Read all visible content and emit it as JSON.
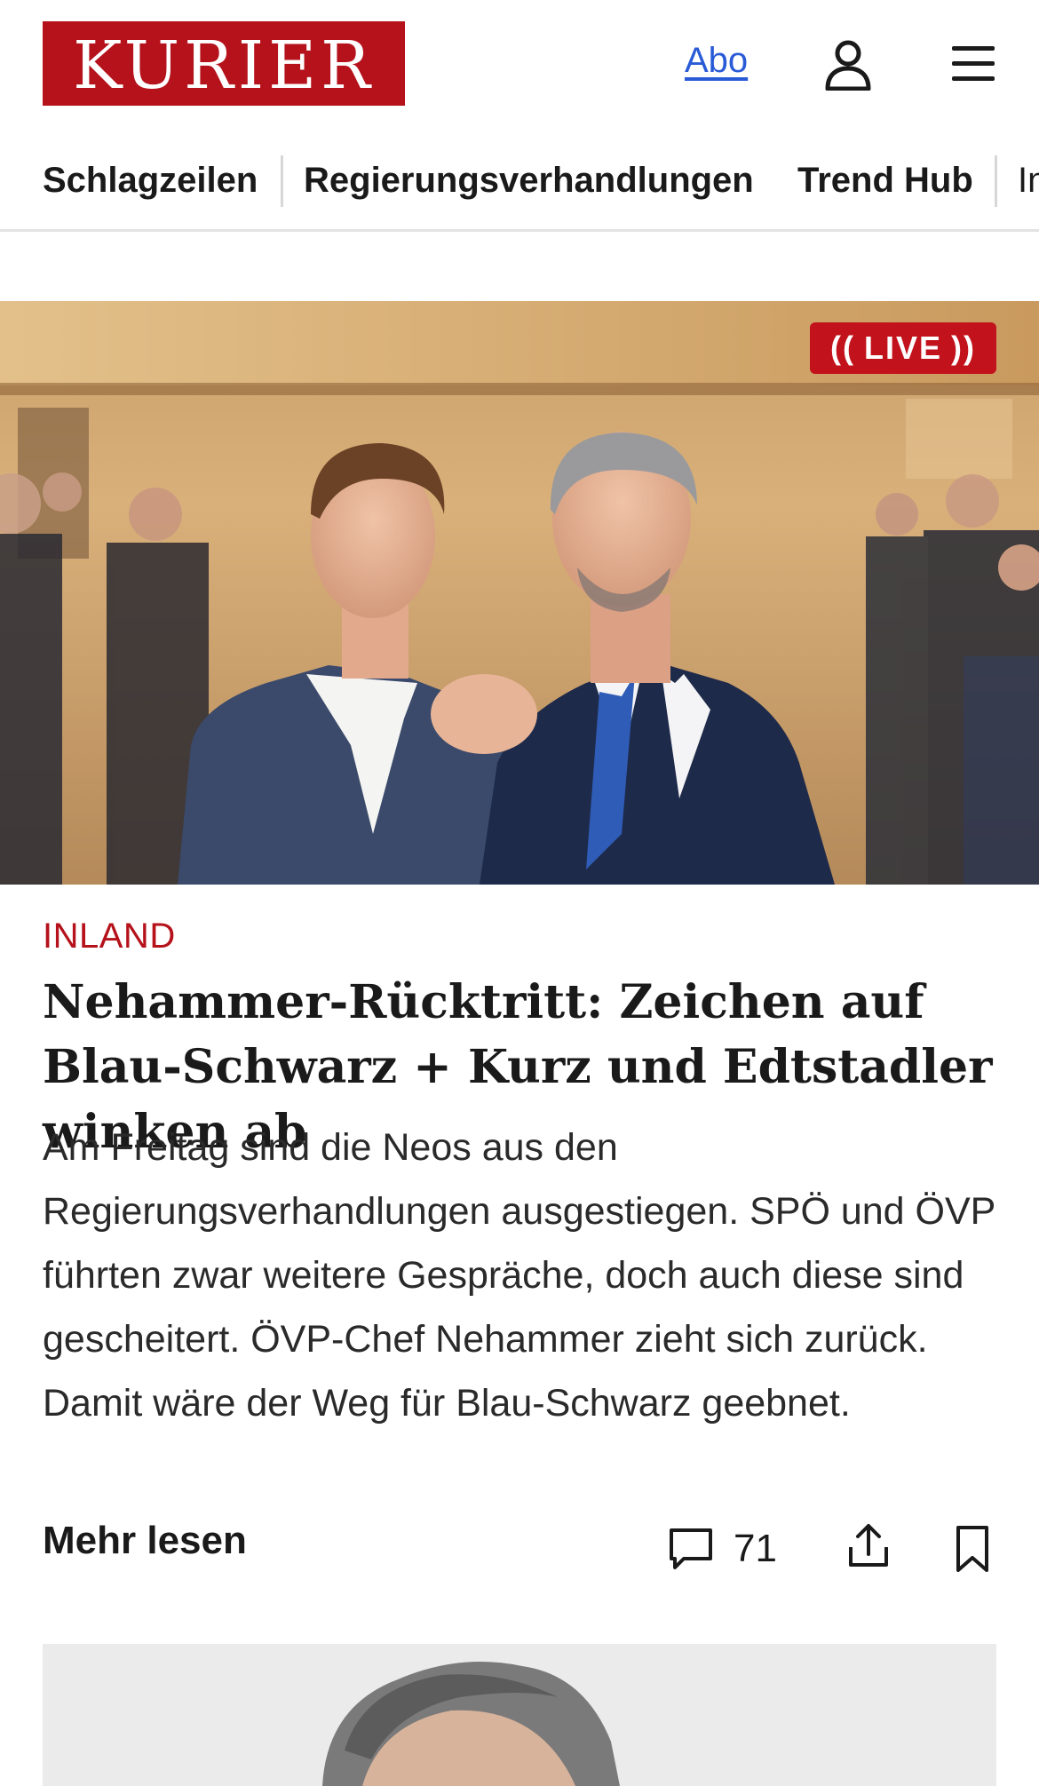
{
  "brand": {
    "logo_text": "KURIER",
    "accent_color": "#b5121b"
  },
  "header": {
    "abo_label": "Abo",
    "user_icon": "user-icon",
    "menu_icon": "hamburger-menu-icon"
  },
  "nav": {
    "items": [
      {
        "label": "Schlagzeilen"
      },
      {
        "label": "Regierungsverhandlungen"
      },
      {
        "label": "Trend Hub"
      },
      {
        "label": "In"
      }
    ]
  },
  "article": {
    "live_badge": "LIVE",
    "category": "INLAND",
    "headline": "Nehammer-Rücktritt: Zeichen auf Blau-Schwarz + Kurz und Edtstadler winken ab",
    "teaser": "Am Freitag sind die Neos aus den Regierungsverhandlungen ausgestiegen. SPÖ und ÖVP führten zwar weitere Gespräche, doch auch diese sind gescheitert. ÖVP-Chef Nehammer zieht sich zurück. Damit wäre der Weg für Blau-Schwarz geebnet.",
    "more_label": "Mehr lesen",
    "comment_count": "71",
    "icons": {
      "comment": "comment-icon",
      "share": "share-icon",
      "bookmark": "bookmark-icon"
    }
  }
}
